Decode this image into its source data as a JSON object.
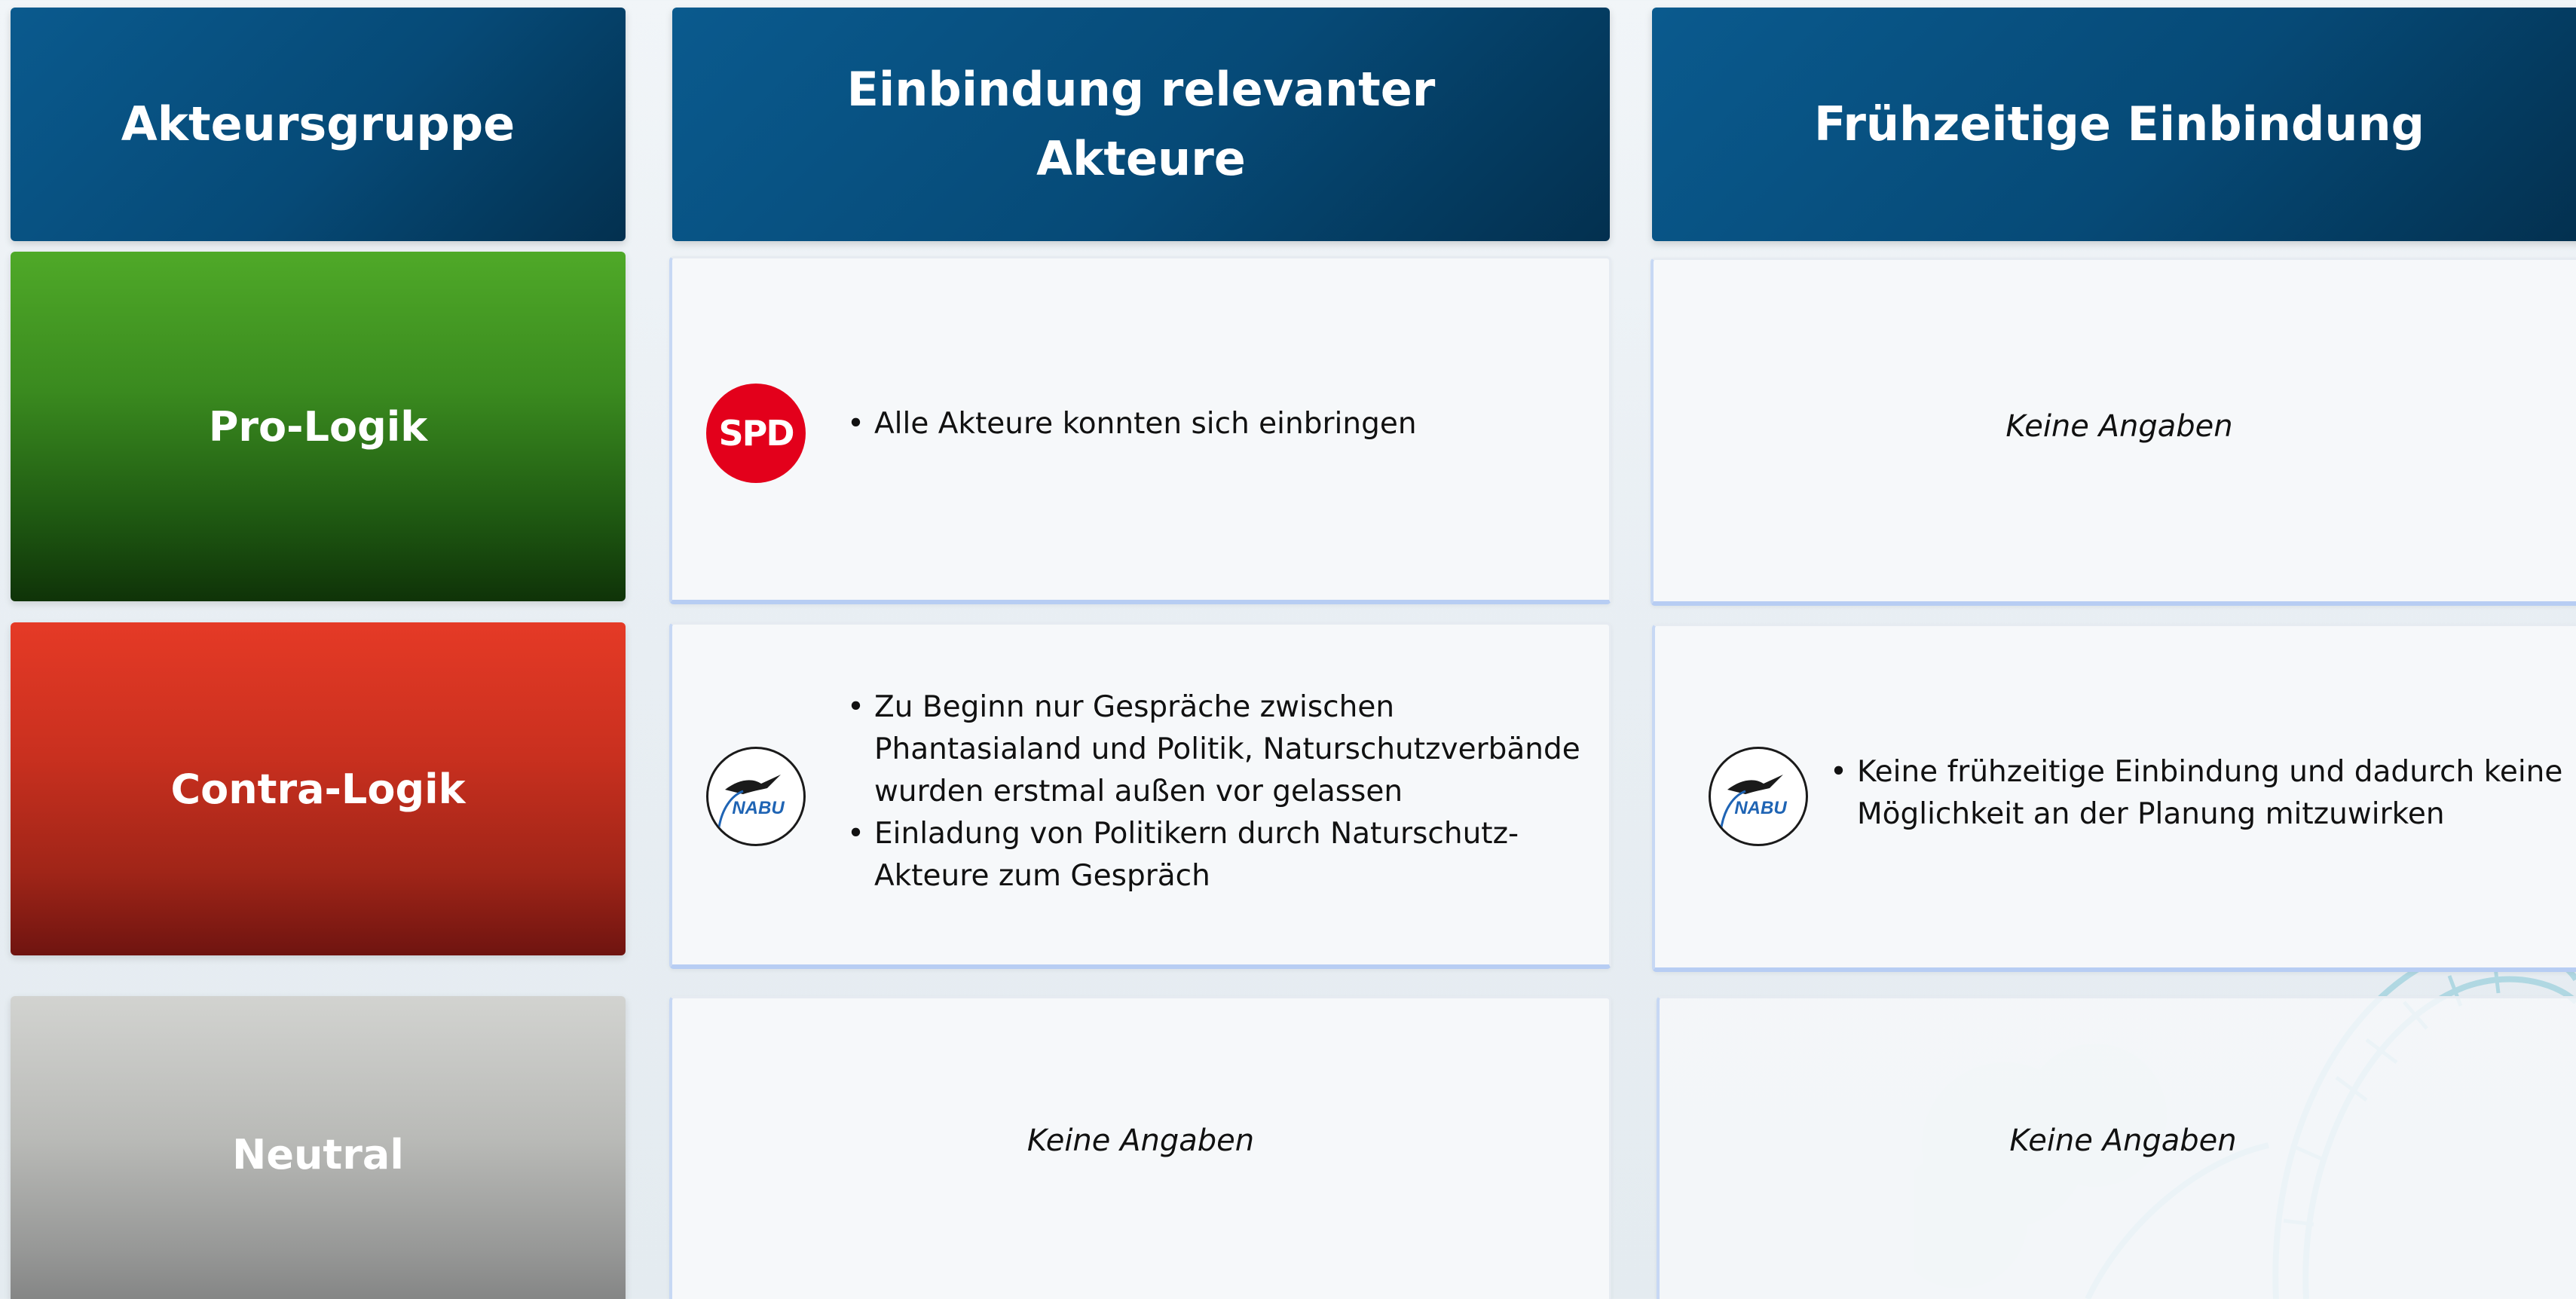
{
  "headers": {
    "col1": "Akteursgruppe",
    "col2_line1": "Einbindung relevanter",
    "col2_line2": "Akteure",
    "col3": "Frühzeitige Einbindung"
  },
  "rows": {
    "pro": {
      "label": "Pro-Logik",
      "col2": {
        "logo": "SPD",
        "bullets": [
          "Alle Akteure konnten sich einbringen"
        ]
      },
      "col3": {
        "text": "Keine Angaben"
      }
    },
    "contra": {
      "label": "Contra-Logik",
      "col2": {
        "logo": "NABU",
        "bullets": [
          {
            "line1": "Zu Beginn nur Gespräche zwischen",
            "line2": "Phantasialand und Politik, Naturschutzverbände",
            "line3": "wurden erstmal außen vor gelassen"
          },
          {
            "line1": "Einladung von Politikern durch Naturschutz-",
            "line2": "Akteure zum Gespräch"
          }
        ]
      },
      "col3": {
        "logo": "NABU",
        "bullets": [
          {
            "line1": "Keine frühzeitige Einbindung und dadurch keine",
            "line2": "Möglichkeit an der Planung mitzuwirken"
          }
        ]
      }
    },
    "neutral": {
      "label": "Neutral",
      "col2": {
        "text": "Keine Angaben"
      },
      "col3": {
        "text": "Keine Angaben"
      }
    }
  },
  "colors": {
    "header": "#064a77",
    "pro": "#3a8a1f",
    "contra": "#c9301f",
    "neutral": "#b9bab7",
    "spd_red": "#e3001b",
    "nabu_blue": "#1f64b4"
  }
}
